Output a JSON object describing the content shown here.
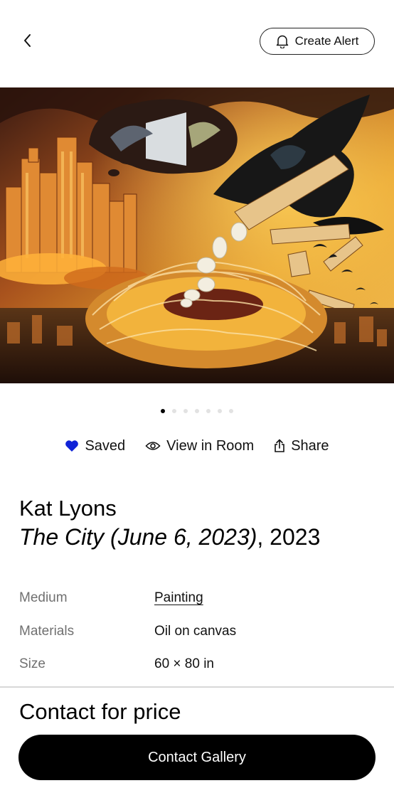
{
  "header": {
    "back_icon": "chevron-left-icon",
    "alert_icon": "bell-icon",
    "alert_label": "Create Alert"
  },
  "artwork": {
    "carousel_total": 7,
    "carousel_active": 1
  },
  "actions": {
    "saved_label": "Saved",
    "saved_icon": "heart-icon",
    "saved_color": "#1023d7",
    "view_label": "View in Room",
    "view_icon": "eye-icon",
    "share_label": "Share",
    "share_icon": "share-icon"
  },
  "artist": "Kat Lyons",
  "title": "The City (June 6, 2023)",
  "year": "2023",
  "details": [
    {
      "label": "Medium",
      "value": "Painting",
      "link": true
    },
    {
      "label": "Materials",
      "value": "Oil on canvas",
      "link": false
    },
    {
      "label": "Size",
      "value": "60 × 80 in",
      "link": false
    }
  ],
  "price": "Contact for price",
  "cta_label": "Contact Gallery"
}
